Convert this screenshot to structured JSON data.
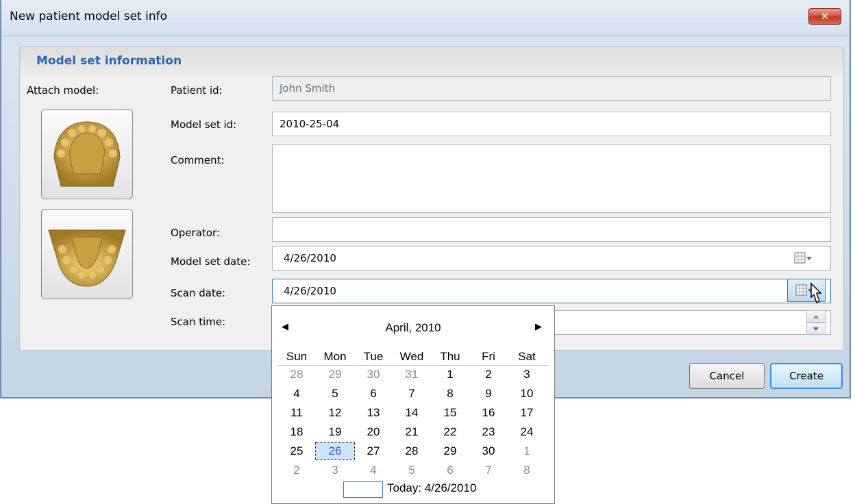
{
  "window": {
    "title": "New patient model set info"
  },
  "panel": {
    "title": "Model set information"
  },
  "labels": {
    "attach_model": "Attach model:",
    "patient_id": "Patient id:",
    "model_set_id": "Model set id:",
    "comment": "Comment:",
    "operator": "Operator:",
    "model_set_date": "Model set date:",
    "scan_date": "Scan date:",
    "scan_time": "Scan time:"
  },
  "fields": {
    "patient_id": "John Smith",
    "model_set_id": "2010-25-04",
    "comment": "",
    "operator": "",
    "model_set_date": "4/26/2010",
    "scan_date": "4/26/2010"
  },
  "buttons": {
    "cancel": "Cancel",
    "create": "Create"
  },
  "calendar": {
    "month_label": "April, 2010",
    "weekdays": [
      "Sun",
      "Mon",
      "Tue",
      "Wed",
      "Thu",
      "Fri",
      "Sat"
    ],
    "weeks": [
      [
        "28",
        "29",
        "30",
        "31",
        "1",
        "2",
        "3"
      ],
      [
        "4",
        "5",
        "6",
        "7",
        "8",
        "9",
        "10"
      ],
      [
        "11",
        "12",
        "13",
        "14",
        "15",
        "16",
        "17"
      ],
      [
        "18",
        "19",
        "20",
        "21",
        "22",
        "23",
        "24"
      ],
      [
        "25",
        "26",
        "27",
        "28",
        "29",
        "30",
        "1"
      ],
      [
        "2",
        "3",
        "4",
        "5",
        "6",
        "7",
        "8"
      ]
    ],
    "selected": "26",
    "today_label": "Today: 4/26/2010"
  },
  "icons": {
    "close": "close-icon",
    "calendar": "calendar-icon",
    "prev": "chevron-left-icon",
    "next": "chevron-right-icon",
    "cursor": "mouse-pointer-icon",
    "upper_jaw": "upper-jaw-model-icon",
    "lower_jaw": "lower-jaw-model-icon"
  }
}
